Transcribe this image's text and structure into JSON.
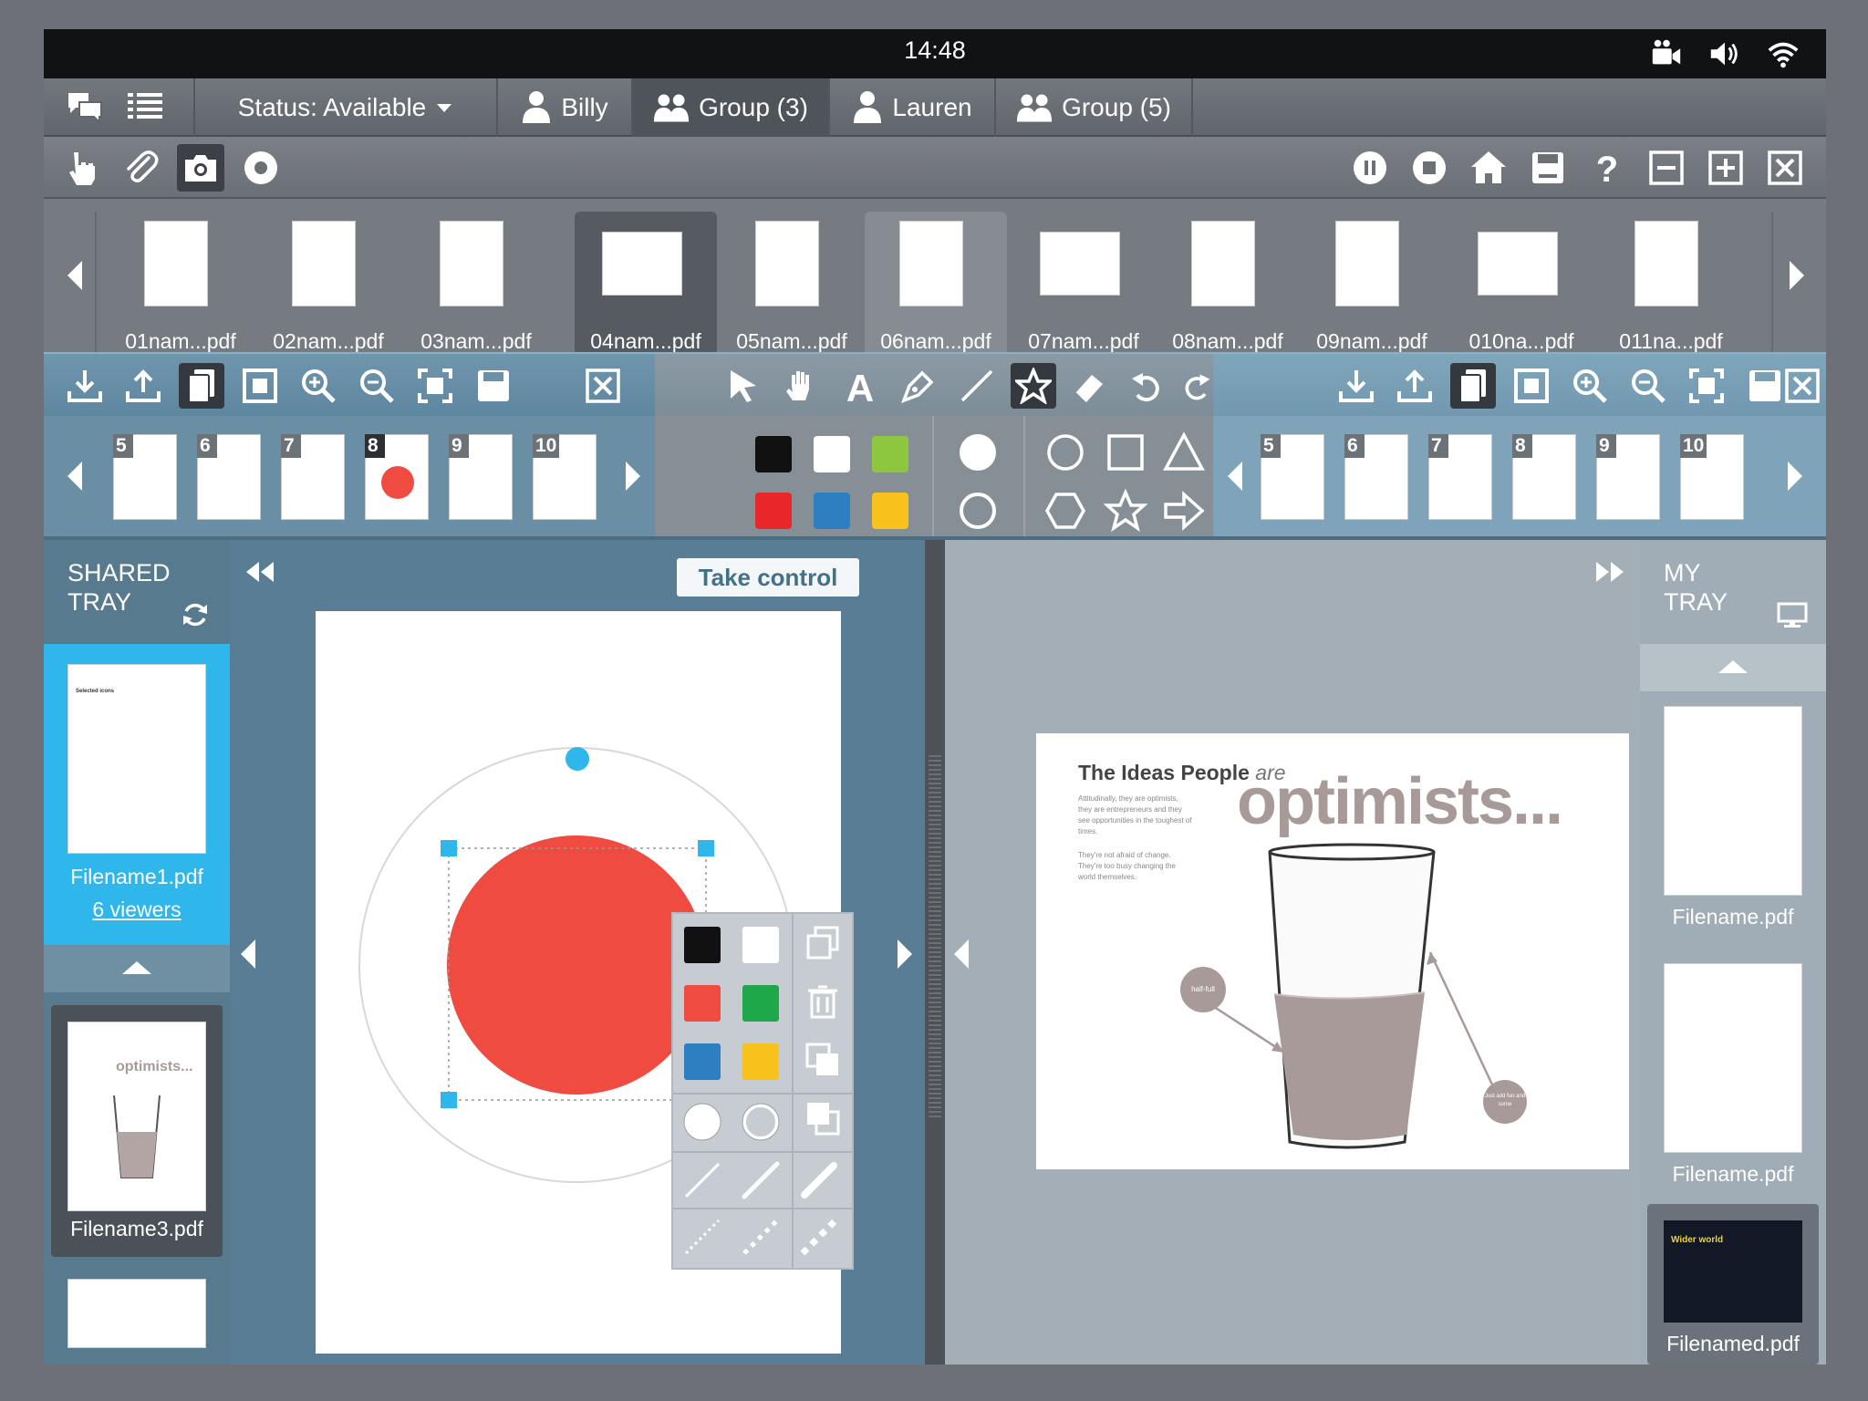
{
  "status_bar": {
    "time": "14:48"
  },
  "contacts": {
    "status": "Status: Available",
    "tabs": [
      {
        "label": "Billy",
        "type": "person"
      },
      {
        "label": "Group (3)",
        "type": "group"
      },
      {
        "label": "Lauren",
        "type": "person"
      },
      {
        "label": "Group (5)",
        "type": "group"
      }
    ]
  },
  "files": [
    "01nam...pdf",
    "02nam...pdf",
    "03nam...pdf",
    "04nam...pdf",
    "05nam...pdf",
    "06nam...pdf",
    "07nam...pdf",
    "08nam...pdf",
    "09nam...pdf",
    "010na...pdf",
    "011na...pdf"
  ],
  "left_pages": [
    "5",
    "6",
    "7",
    "8",
    "9",
    "10"
  ],
  "right_pages": [
    "5",
    "6",
    "7",
    "8",
    "9",
    "10"
  ],
  "colors": {
    "black": "#111111",
    "white": "#ffffff",
    "green": "#8dc63f",
    "red": "#e8262a",
    "blue": "#2e7fc2",
    "yellow": "#f7c21b",
    "accent_blue": "#2fb6ea",
    "shape_red": "#ef4b40"
  },
  "shared_tray": {
    "title_line1": "SHARED",
    "title_line2": "TRAY",
    "items": [
      {
        "name": "Filename1.pdf",
        "viewers": "6 viewers",
        "thumb_title": "Selected icons"
      },
      {
        "name": "Filename3.pdf",
        "thumb_title": "optimists..."
      }
    ]
  },
  "my_tray": {
    "title_line1": "MY",
    "title_line2": "TRAY",
    "items": [
      {
        "name": "Filename.pdf"
      },
      {
        "name": "Filename.pdf"
      },
      {
        "name": "Filenamed.pdf",
        "thumb_title": "Wider world"
      }
    ]
  },
  "left_pane": {
    "take_control": "Take control"
  },
  "right_pane": {
    "heading_small": "The Ideas People",
    "heading_are": "are",
    "heading_big": "optimists...",
    "body_text": "Attitudinally, they are optimists, they are entrepreneurs and they see opportunities in the toughest of times.",
    "body_text2": "They're not afraid of change. They're too busy changing the world themselves.",
    "label_half_full": "half-full",
    "label_just_add": "Just add fun and some"
  }
}
